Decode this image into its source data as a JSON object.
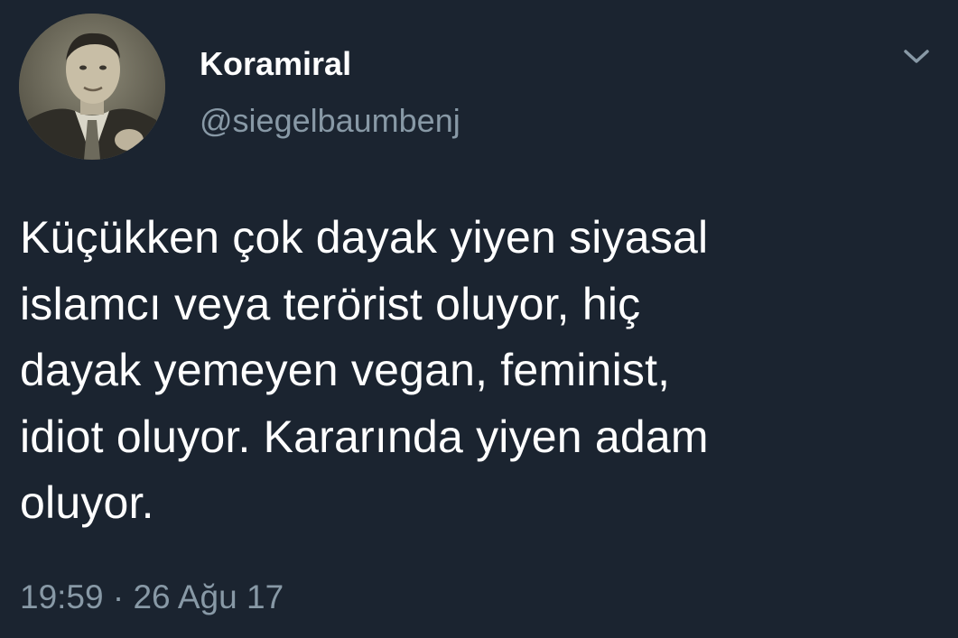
{
  "tweet": {
    "author": {
      "display_name": "Koramiral",
      "handle": "@siegelbaumbenj",
      "avatar_icon": "profile-photo"
    },
    "menu_icon": "chevron-down-icon",
    "text_lines": [
      "Küçükken çok dayak yiyen siyasal",
      "islamcı veya terörist oluyor, hiç",
      "dayak yemeyen vegan, feminist,",
      "idiot oluyor. Kararında yiyen adam",
      "oluyor."
    ],
    "time": "19:59",
    "separator": "·",
    "date": "26 Ağu 17"
  },
  "colors": {
    "background": "#1b2430",
    "primary_text": "#ffffff",
    "secondary_text": "#8899a6"
  }
}
